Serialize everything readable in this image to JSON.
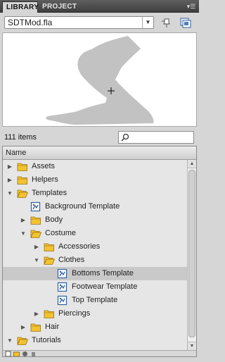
{
  "tabs": [
    {
      "label": "LIBRARY",
      "active": true
    },
    {
      "label": "PROJECT",
      "active": false
    }
  ],
  "document": {
    "selected": "SDTMod.fla"
  },
  "library": {
    "item_count": "111 items",
    "column_header": "Name",
    "items": [
      {
        "label": "Assets",
        "type": "folder",
        "expanded": false,
        "depth": 0
      },
      {
        "label": "Helpers",
        "type": "folder",
        "expanded": false,
        "depth": 0
      },
      {
        "label": "Templates",
        "type": "folder",
        "expanded": true,
        "depth": 0
      },
      {
        "label": "Background Template",
        "type": "symbol",
        "depth": 1
      },
      {
        "label": "Body",
        "type": "folder",
        "expanded": false,
        "depth": 1
      },
      {
        "label": "Costume",
        "type": "folder",
        "expanded": true,
        "depth": 1
      },
      {
        "label": "Accessories",
        "type": "folder",
        "expanded": false,
        "depth": 2
      },
      {
        "label": "Clothes",
        "type": "folder",
        "expanded": true,
        "depth": 2
      },
      {
        "label": "Bottoms Template",
        "type": "symbol",
        "depth": 3,
        "selected": true
      },
      {
        "label": "Footwear Template",
        "type": "symbol",
        "depth": 3
      },
      {
        "label": "Top Template",
        "type": "symbol",
        "depth": 3
      },
      {
        "label": "Piercings",
        "type": "folder",
        "expanded": false,
        "depth": 2
      },
      {
        "label": "Hair",
        "type": "folder",
        "expanded": false,
        "depth": 1
      },
      {
        "label": "Tutorials",
        "type": "folder",
        "expanded": true,
        "depth": 0
      }
    ]
  },
  "colors": {
    "folder": "#f2c230",
    "folder_edge": "#9a7414",
    "symbol": "#2f5f9c",
    "selection": "#c9c9c9",
    "preview_shape": "#c2c2c2"
  },
  "icons": {
    "panel_menu": "panel-menu-icon",
    "pin": "pin-icon",
    "new_library_panel": "new-library-panel-icon",
    "search": "search-icon",
    "registration": "crosshair-icon"
  }
}
